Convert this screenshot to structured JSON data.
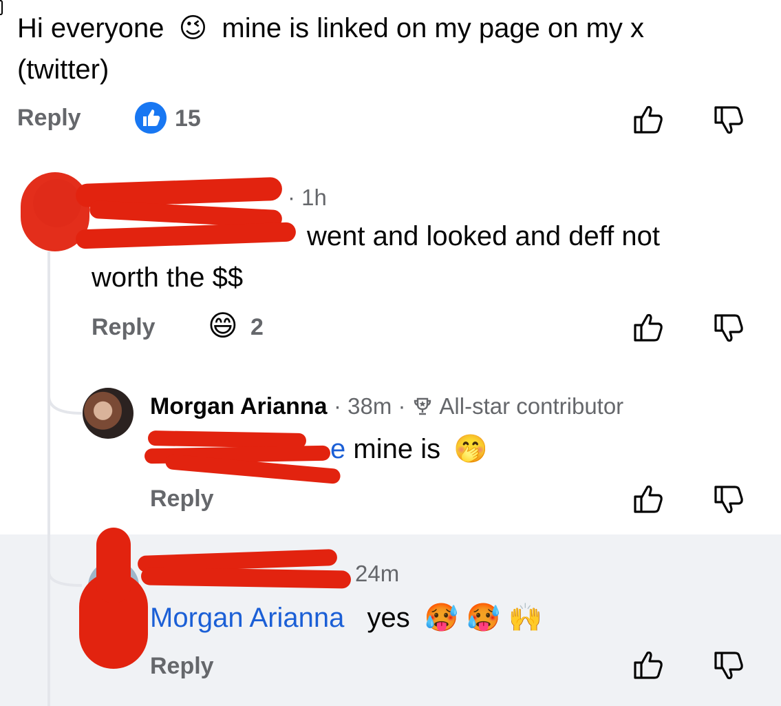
{
  "comments": [
    {
      "text_line1": "Hi everyone",
      "text_line1b": "mine is linked on my page on my x",
      "text_line2": "(twitter)",
      "reply": "Reply",
      "reaction_count": "15"
    },
    {
      "time": "· 1h",
      "text_line1": "went and looked and deff not",
      "text_line2": "worth the $$",
      "reply": "Reply",
      "reaction_count": "2"
    },
    {
      "author": "Morgan Arianna",
      "time": "· 38m ·",
      "badge": "All-star contributor",
      "mention_tail": "e",
      "text": "mine is",
      "reply": "Reply"
    },
    {
      "time": "24m",
      "mention": "Morgan Arianna",
      "text": "yes",
      "reply": "Reply"
    }
  ],
  "icons": {
    "like_reaction": "like-reaction-icon",
    "wink_emoji": "😉",
    "grin_emoji": "😄",
    "peek_emoji": "🤭",
    "hot_emoji": "🥵",
    "raised_hands_emoji": "🙌",
    "trophy": "trophy-icon",
    "thumbs_up": "thumbs-up-icon",
    "thumbs_down": "thumbs-down-icon"
  },
  "colors": {
    "like_blue": "#1877f2",
    "meta_gray": "#65676b",
    "mention_blue": "#1b5fd6",
    "highlight_bg": "#f0f2f5",
    "redaction_red": "#e2230f"
  }
}
